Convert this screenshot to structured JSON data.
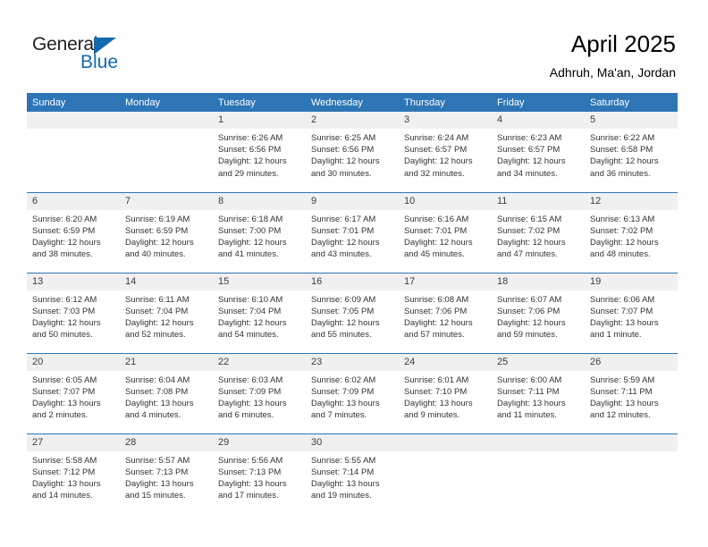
{
  "brand": {
    "name_part1": "General",
    "name_part2": "Blue",
    "accent_color": "#1569b0"
  },
  "header": {
    "title": "April 2025",
    "subtitle": "Adhruh, Ma'an, Jordan"
  },
  "theme": {
    "header_blue": "#2e75b6",
    "daynum_gray": "#f0f0f0",
    "text": "#333333"
  },
  "weekday_headers": [
    "Sunday",
    "Monday",
    "Tuesday",
    "Wednesday",
    "Thursday",
    "Friday",
    "Saturday"
  ],
  "labels": {
    "sunrise": "Sunrise:",
    "sunset": "Sunset:",
    "daylight": "Daylight:"
  },
  "weeks": [
    [
      {
        "day": "",
        "lines": []
      },
      {
        "day": "",
        "lines": []
      },
      {
        "day": "1",
        "lines": [
          "Sunrise: 6:26 AM",
          "Sunset: 6:56 PM",
          "Daylight: 12 hours and 29 minutes."
        ]
      },
      {
        "day": "2",
        "lines": [
          "Sunrise: 6:25 AM",
          "Sunset: 6:56 PM",
          "Daylight: 12 hours and 30 minutes."
        ]
      },
      {
        "day": "3",
        "lines": [
          "Sunrise: 6:24 AM",
          "Sunset: 6:57 PM",
          "Daylight: 12 hours and 32 minutes."
        ]
      },
      {
        "day": "4",
        "lines": [
          "Sunrise: 6:23 AM",
          "Sunset: 6:57 PM",
          "Daylight: 12 hours and 34 minutes."
        ]
      },
      {
        "day": "5",
        "lines": [
          "Sunrise: 6:22 AM",
          "Sunset: 6:58 PM",
          "Daylight: 12 hours and 36 minutes."
        ]
      }
    ],
    [
      {
        "day": "6",
        "lines": [
          "Sunrise: 6:20 AM",
          "Sunset: 6:59 PM",
          "Daylight: 12 hours and 38 minutes."
        ]
      },
      {
        "day": "7",
        "lines": [
          "Sunrise: 6:19 AM",
          "Sunset: 6:59 PM",
          "Daylight: 12 hours and 40 minutes."
        ]
      },
      {
        "day": "8",
        "lines": [
          "Sunrise: 6:18 AM",
          "Sunset: 7:00 PM",
          "Daylight: 12 hours and 41 minutes."
        ]
      },
      {
        "day": "9",
        "lines": [
          "Sunrise: 6:17 AM",
          "Sunset: 7:01 PM",
          "Daylight: 12 hours and 43 minutes."
        ]
      },
      {
        "day": "10",
        "lines": [
          "Sunrise: 6:16 AM",
          "Sunset: 7:01 PM",
          "Daylight: 12 hours and 45 minutes."
        ]
      },
      {
        "day": "11",
        "lines": [
          "Sunrise: 6:15 AM",
          "Sunset: 7:02 PM",
          "Daylight: 12 hours and 47 minutes."
        ]
      },
      {
        "day": "12",
        "lines": [
          "Sunrise: 6:13 AM",
          "Sunset: 7:02 PM",
          "Daylight: 12 hours and 48 minutes."
        ]
      }
    ],
    [
      {
        "day": "13",
        "lines": [
          "Sunrise: 6:12 AM",
          "Sunset: 7:03 PM",
          "Daylight: 12 hours and 50 minutes."
        ]
      },
      {
        "day": "14",
        "lines": [
          "Sunrise: 6:11 AM",
          "Sunset: 7:04 PM",
          "Daylight: 12 hours and 52 minutes."
        ]
      },
      {
        "day": "15",
        "lines": [
          "Sunrise: 6:10 AM",
          "Sunset: 7:04 PM",
          "Daylight: 12 hours and 54 minutes."
        ]
      },
      {
        "day": "16",
        "lines": [
          "Sunrise: 6:09 AM",
          "Sunset: 7:05 PM",
          "Daylight: 12 hours and 55 minutes."
        ]
      },
      {
        "day": "17",
        "lines": [
          "Sunrise: 6:08 AM",
          "Sunset: 7:06 PM",
          "Daylight: 12 hours and 57 minutes."
        ]
      },
      {
        "day": "18",
        "lines": [
          "Sunrise: 6:07 AM",
          "Sunset: 7:06 PM",
          "Daylight: 12 hours and 59 minutes."
        ]
      },
      {
        "day": "19",
        "lines": [
          "Sunrise: 6:06 AM",
          "Sunset: 7:07 PM",
          "Daylight: 13 hours and 1 minute."
        ]
      }
    ],
    [
      {
        "day": "20",
        "lines": [
          "Sunrise: 6:05 AM",
          "Sunset: 7:07 PM",
          "Daylight: 13 hours and 2 minutes."
        ]
      },
      {
        "day": "21",
        "lines": [
          "Sunrise: 6:04 AM",
          "Sunset: 7:08 PM",
          "Daylight: 13 hours and 4 minutes."
        ]
      },
      {
        "day": "22",
        "lines": [
          "Sunrise: 6:03 AM",
          "Sunset: 7:09 PM",
          "Daylight: 13 hours and 6 minutes."
        ]
      },
      {
        "day": "23",
        "lines": [
          "Sunrise: 6:02 AM",
          "Sunset: 7:09 PM",
          "Daylight: 13 hours and 7 minutes."
        ]
      },
      {
        "day": "24",
        "lines": [
          "Sunrise: 6:01 AM",
          "Sunset: 7:10 PM",
          "Daylight: 13 hours and 9 minutes."
        ]
      },
      {
        "day": "25",
        "lines": [
          "Sunrise: 6:00 AM",
          "Sunset: 7:11 PM",
          "Daylight: 13 hours and 11 minutes."
        ]
      },
      {
        "day": "26",
        "lines": [
          "Sunrise: 5:59 AM",
          "Sunset: 7:11 PM",
          "Daylight: 13 hours and 12 minutes."
        ]
      }
    ],
    [
      {
        "day": "27",
        "lines": [
          "Sunrise: 5:58 AM",
          "Sunset: 7:12 PM",
          "Daylight: 13 hours and 14 minutes."
        ]
      },
      {
        "day": "28",
        "lines": [
          "Sunrise: 5:57 AM",
          "Sunset: 7:13 PM",
          "Daylight: 13 hours and 15 minutes."
        ]
      },
      {
        "day": "29",
        "lines": [
          "Sunrise: 5:56 AM",
          "Sunset: 7:13 PM",
          "Daylight: 13 hours and 17 minutes."
        ]
      },
      {
        "day": "30",
        "lines": [
          "Sunrise: 5:55 AM",
          "Sunset: 7:14 PM",
          "Daylight: 13 hours and 19 minutes."
        ]
      },
      {
        "day": "",
        "lines": []
      },
      {
        "day": "",
        "lines": []
      },
      {
        "day": "",
        "lines": []
      }
    ]
  ]
}
